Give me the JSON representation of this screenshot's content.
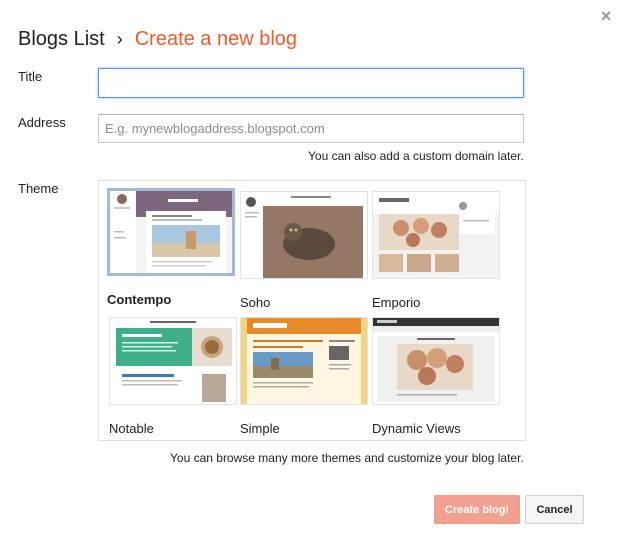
{
  "header": {
    "root": "Blogs List",
    "separator": "›",
    "current": "Create a new blog"
  },
  "close_glyph": "×",
  "form": {
    "title_label": "Title",
    "title_value": "",
    "address_label": "Address",
    "address_placeholder": "E.g. mynewblogaddress.blogspot.com",
    "address_hint": "You can also add a custom domain later.",
    "theme_label": "Theme",
    "theme_hint": "You can browse many more themes and customize your blog later."
  },
  "themes": [
    {
      "name": "Contempo",
      "selected": true
    },
    {
      "name": "Soho",
      "selected": false
    },
    {
      "name": "Emporio",
      "selected": false
    },
    {
      "name": "Notable",
      "selected": false
    },
    {
      "name": "Simple",
      "selected": false
    },
    {
      "name": "Dynamic Views",
      "selected": false
    }
  ],
  "buttons": {
    "create": "Create blog!",
    "cancel": "Cancel"
  },
  "colors": {
    "accent": "#f05a28",
    "focus": "#4d90fe",
    "create_button": "#f2a08f",
    "selected_theme_border": "#a3b9d9"
  }
}
